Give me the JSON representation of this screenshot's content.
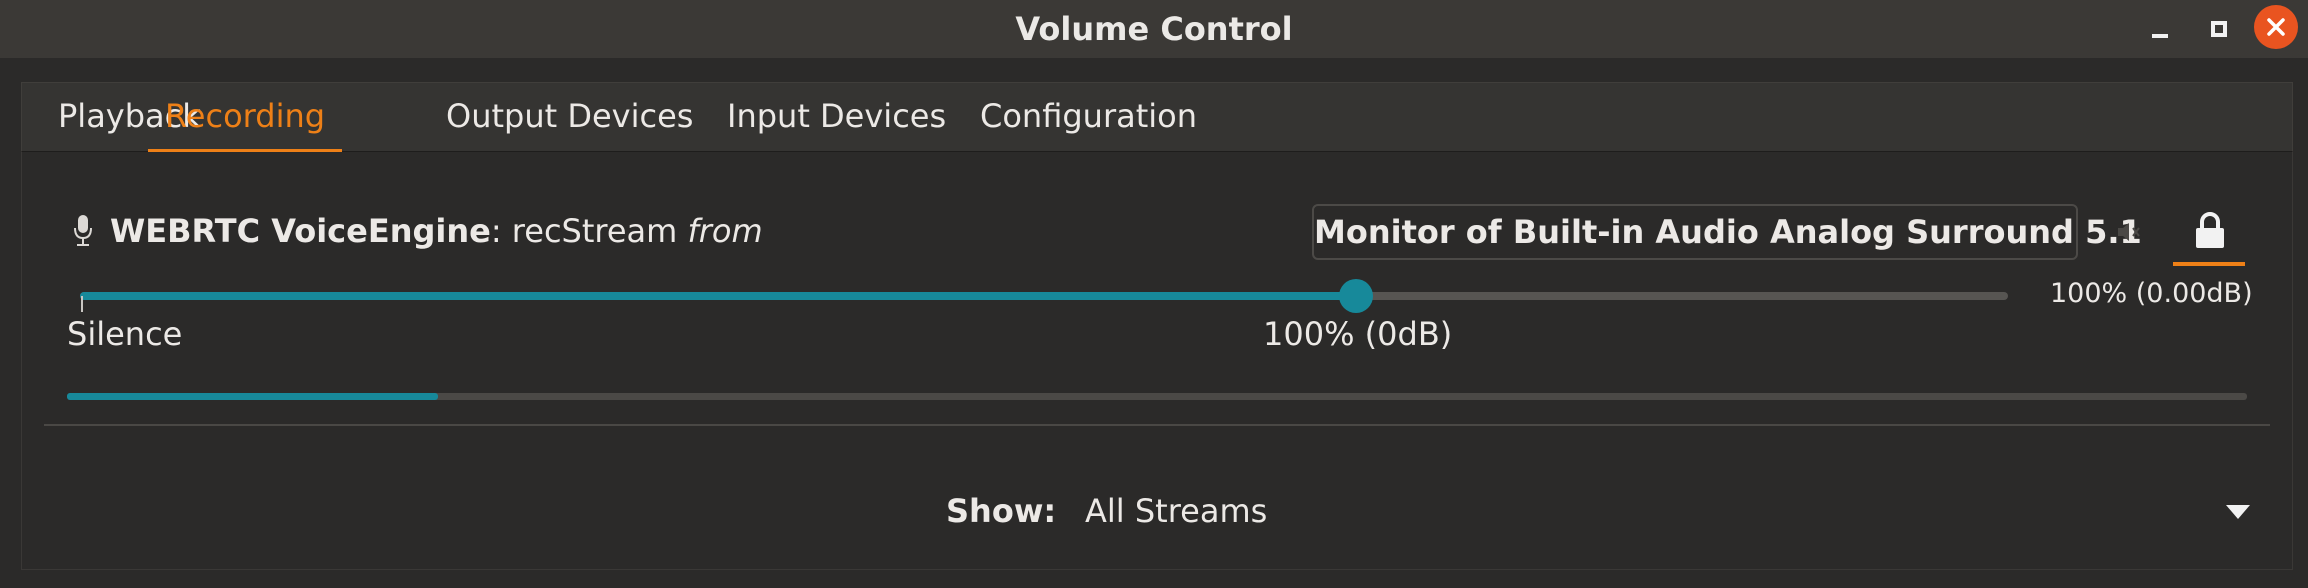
{
  "window": {
    "title": "Volume Control"
  },
  "tabs": [
    {
      "label": "Playback",
      "active": false
    },
    {
      "label": "Recording",
      "active": true
    },
    {
      "label": "Output Devices",
      "active": false
    },
    {
      "label": "Input Devices",
      "active": false
    },
    {
      "label": "Configuration",
      "active": false
    }
  ],
  "stream": {
    "icon": "microphone-icon",
    "app_name": "WEBRTC VoiceEngine",
    "separator": ": ",
    "stream_name": "recStream",
    "from_word": "from",
    "device": "Monitor of Built-in Audio Analog Surround 5.1",
    "volume_percent": 100,
    "volume_readout": "100% (0.00dB)",
    "scale_min_label": "Silence",
    "scale_mark_label": "100% (0dB)",
    "peak_level_fraction": 0.17,
    "locked": true
  },
  "filter": {
    "label": "Show:",
    "value": "All Streams"
  },
  "colors": {
    "accent": "#ee8017",
    "slider": "#17899a",
    "close_button": "#e95420"
  }
}
